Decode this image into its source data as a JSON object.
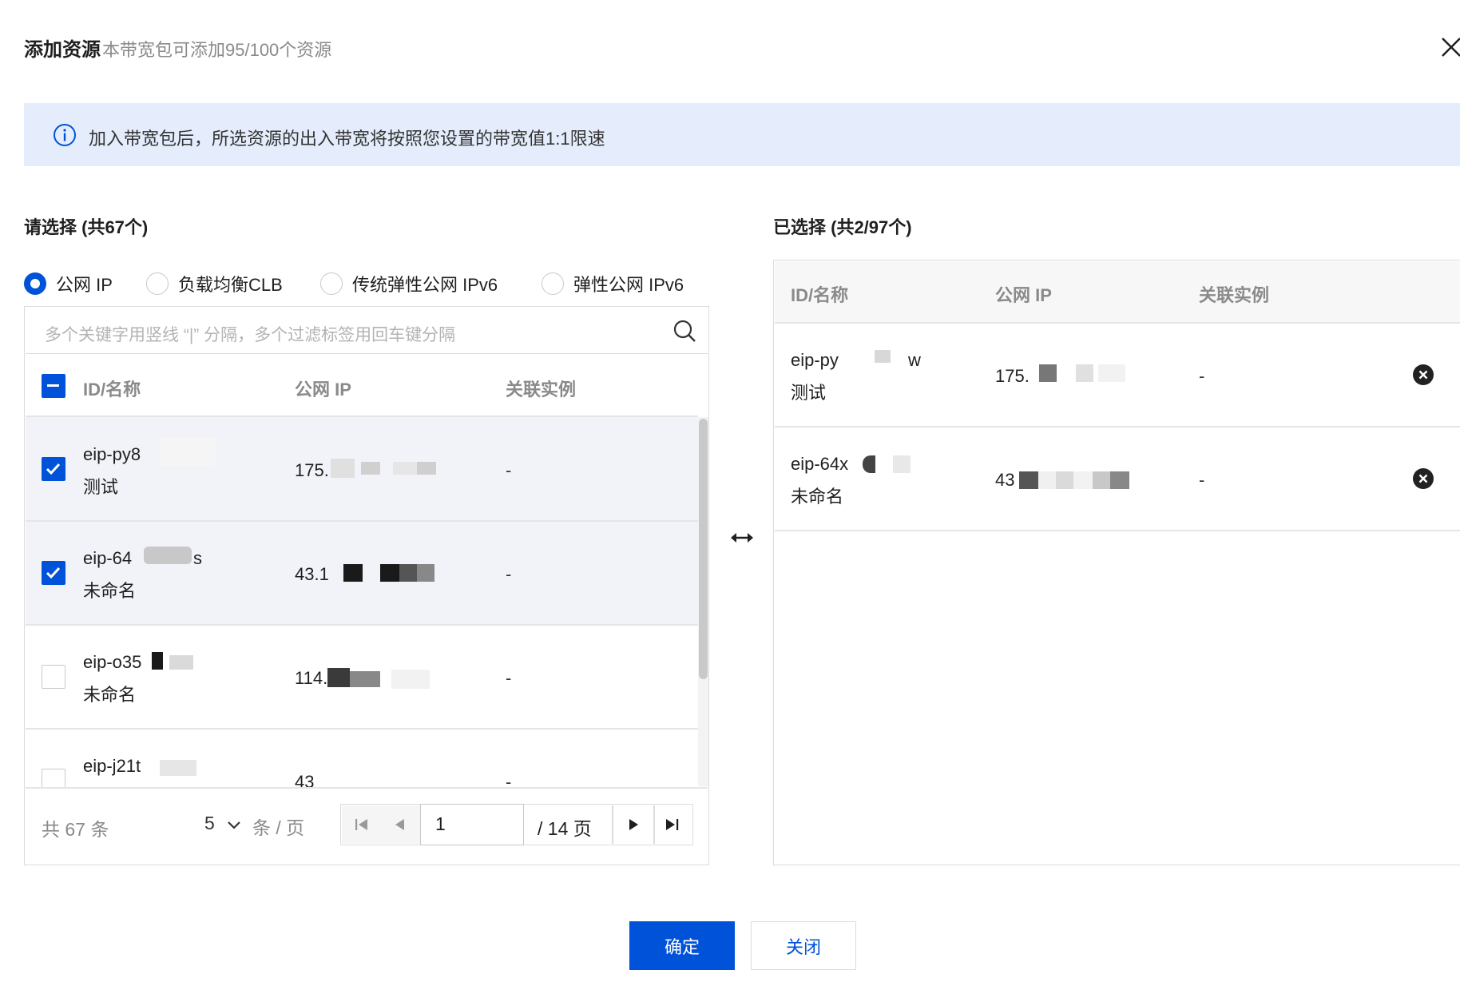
{
  "dialog": {
    "title": "添加资源",
    "subtitle": "本带宽包可添加95/100个资源"
  },
  "banner": {
    "text": "加入带宽包后，所选资源的出入带宽将按照您设置的带宽值1:1限速"
  },
  "left": {
    "title": "请选择 (共67个)",
    "radios": [
      {
        "label": "公网 IP",
        "checked": true
      },
      {
        "label": "负载均衡CLB",
        "checked": false
      },
      {
        "label": "传统弹性公网 IPv6",
        "checked": false
      },
      {
        "label": "弹性公网 IPv6",
        "checked": false
      }
    ],
    "search_placeholder": "多个关键字用竖线 “|” 分隔，多个过滤标签用回车键分隔",
    "columns": [
      "ID/名称",
      "公网 IP",
      "关联实例"
    ],
    "rows": [
      {
        "id": "eip-py8",
        "name": "测试",
        "ip": "175.",
        "instance": "-",
        "checked": true
      },
      {
        "id": "eip-64",
        "name": "未命名",
        "ip": "43.1",
        "instance": "-",
        "checked": true
      },
      {
        "id": "eip-o35",
        "name": "未命名",
        "ip": "114.",
        "instance": "-",
        "checked": false
      },
      {
        "id": "eip-j21t",
        "name": "",
        "ip": "43",
        "instance": "-",
        "checked": false
      }
    ],
    "pagination": {
      "total": "共 67 条",
      "page_size": "5",
      "page_size_unit": "条 / 页",
      "current_page": "1",
      "total_pages": "/ 14 页"
    }
  },
  "right": {
    "title": "已选择 (共2/97个)",
    "columns": [
      "ID/名称",
      "公网 IP",
      "关联实例"
    ],
    "rows": [
      {
        "id": "eip-py",
        "id_suffix": "w",
        "name": "测试",
        "ip": "175.",
        "instance": "-"
      },
      {
        "id": "eip-64x",
        "id_suffix": "",
        "name": "未命名",
        "ip": "43",
        "instance": "-"
      }
    ]
  },
  "footer": {
    "confirm": "确定",
    "close": "关闭"
  },
  "colors": {
    "primary": "#0052d9",
    "banner_bg": "#e5edfc",
    "selected_row_bg": "#f2f3f8"
  },
  "icons": [
    "close-icon",
    "info-icon",
    "search-icon",
    "chevron-down-icon",
    "first-page-icon",
    "prev-page-icon",
    "next-page-icon",
    "last-page-icon",
    "transfer-arrows-icon",
    "remove-circle-icon",
    "check-icon",
    "indeterminate-icon"
  ]
}
